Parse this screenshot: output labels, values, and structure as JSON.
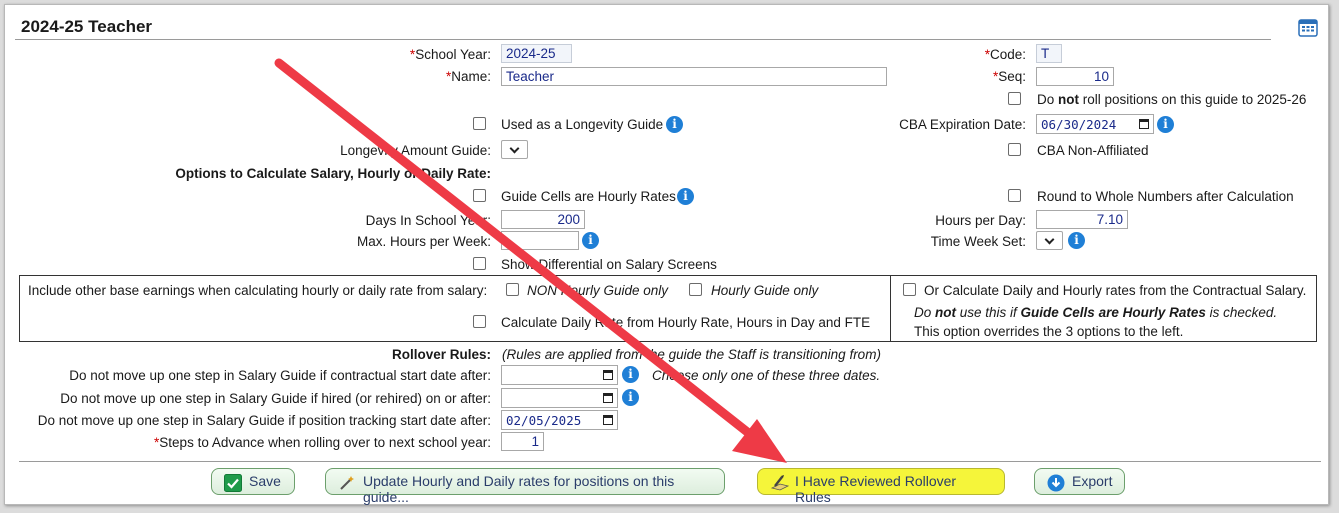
{
  "title": "2024-25 Teacher",
  "fields": {
    "school_year_label": "School Year:",
    "school_year_value": "2024-25",
    "name_label": "Name:",
    "name_value": "Teacher",
    "code_label": "Code:",
    "code_value": "T",
    "seq_label": "Seq:",
    "seq_value": "10",
    "do_label_1": "Do ",
    "do_label_not": "not",
    "do_label_2": " roll positions on this guide to 2025-26",
    "longevity_guide_label": "Used as a Longevity Guide",
    "cba_exp_label": "CBA Expiration Date:",
    "cba_exp_value": "06/30/2024",
    "longevity_amount_label": "Longevity Amount Guide:",
    "cba_non_affiliated_label": "CBA Non-Affiliated",
    "options_heading": "Options to Calculate Salary, Hourly or Daily Rate:",
    "guide_cells_hourly_label": "Guide Cells are Hourly Rates",
    "round_whole_label": "Round to Whole Numbers after Calculation",
    "days_in_school_year_label": "Days In School Year:",
    "days_in_school_year_value": "200",
    "hours_per_day_label": "Hours per Day:",
    "hours_per_day_value": "7.10",
    "max_hours_week_label": "Max. Hours per Week:",
    "max_hours_week_value": "",
    "time_week_set_label": "Time Week Set:",
    "show_differential_label": "Show Differential on Salary Screens"
  },
  "box": {
    "include_label": "Include other base earnings when calculating hourly or daily rate from salary:",
    "non_hourly_label": "NON Hourly Guide only",
    "hourly_only_label": "Hourly Guide only",
    "calc_daily_label": "Calculate Daily Rate from Hourly Rate, Hours in Day and FTE",
    "or_calc_label": "Or Calculate Daily and Hourly rates from the Contractual Salary.",
    "do_not_use_1": "Do ",
    "do_not_use_not": "not",
    "do_not_use_2": " use this if ",
    "do_not_use_bold": "Guide Cells are Hourly Rates",
    "do_not_use_3": " is checked.",
    "overrides_label": "This option overrides the 3 options to the left."
  },
  "rollover": {
    "heading": "Rollover Rules:",
    "note": "(Rules are applied from the guide the Staff is transitioning from)",
    "contractual_label": "Do not move up one step in Salary Guide if contractual start date after:",
    "contractual_value": "",
    "choose_note": "Choose only one of these three dates.",
    "hired_label": "Do not move up one step in Salary Guide if hired (or rehired) on or after:",
    "hired_value": "",
    "position_tracking_label": "Do not move up one step in Salary Guide if position tracking start date after:",
    "position_tracking_value": "02/05/2025",
    "steps_label": "Steps to Advance when rolling over to next school year:",
    "steps_value": "1"
  },
  "buttons": {
    "save": "Save",
    "update_rates": "Update Hourly and Daily rates for positions on this guide...",
    "reviewed": "I Have Reviewed Rollover Rules",
    "export": "Export"
  },
  "colors": {
    "accent_blue": "#1f7fd6",
    "required_red": "#cc0000",
    "highlight_yellow": "#f5f53a",
    "annotation_arrow": "#ee3a46"
  },
  "icons": {
    "calendar": "calendar-icon",
    "info": "info-icon",
    "save": "checkmark-icon",
    "update": "magic-wand-icon",
    "reviewed": "pencil-paper-icon",
    "export": "download-arrow-icon"
  }
}
